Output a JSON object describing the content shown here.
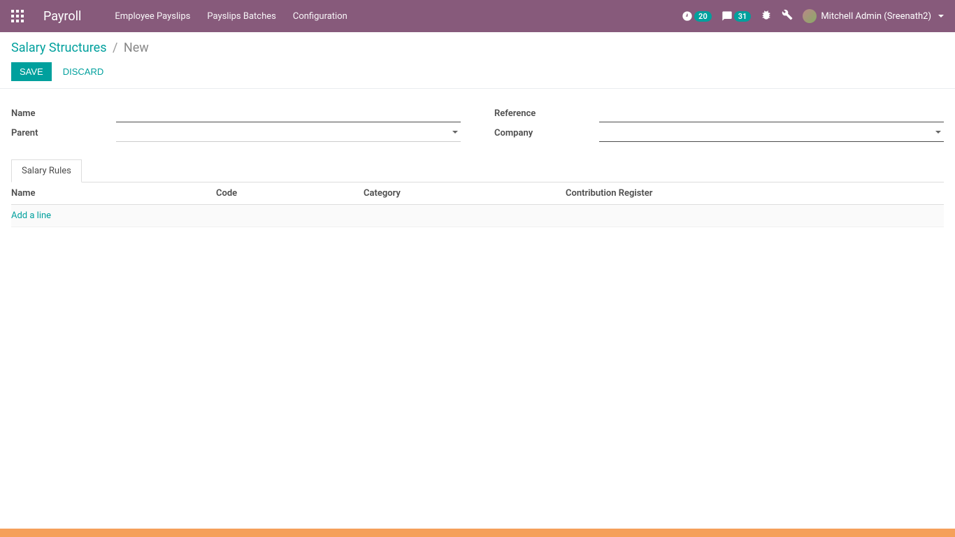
{
  "topbar": {
    "app_title": "Payroll",
    "nav": [
      "Employee Payslips",
      "Payslips Batches",
      "Configuration"
    ],
    "activity_count": "20",
    "messages_count": "31",
    "user_name": "Mitchell Admin (Sreenath2)"
  },
  "breadcrumb": {
    "parent": "Salary Structures",
    "current": "New"
  },
  "buttons": {
    "save": "Save",
    "discard": "Discard"
  },
  "form": {
    "name_label": "Name",
    "name_value": "",
    "parent_label": "Parent",
    "parent_value": "",
    "reference_label": "Reference",
    "reference_value": "",
    "company_label": "Company",
    "company_value": ""
  },
  "tabs": {
    "salary_rules": "Salary Rules"
  },
  "table": {
    "col_name": "Name",
    "col_code": "Code",
    "col_category": "Category",
    "col_contrib": "Contribution Register",
    "add_line": "Add a line"
  }
}
